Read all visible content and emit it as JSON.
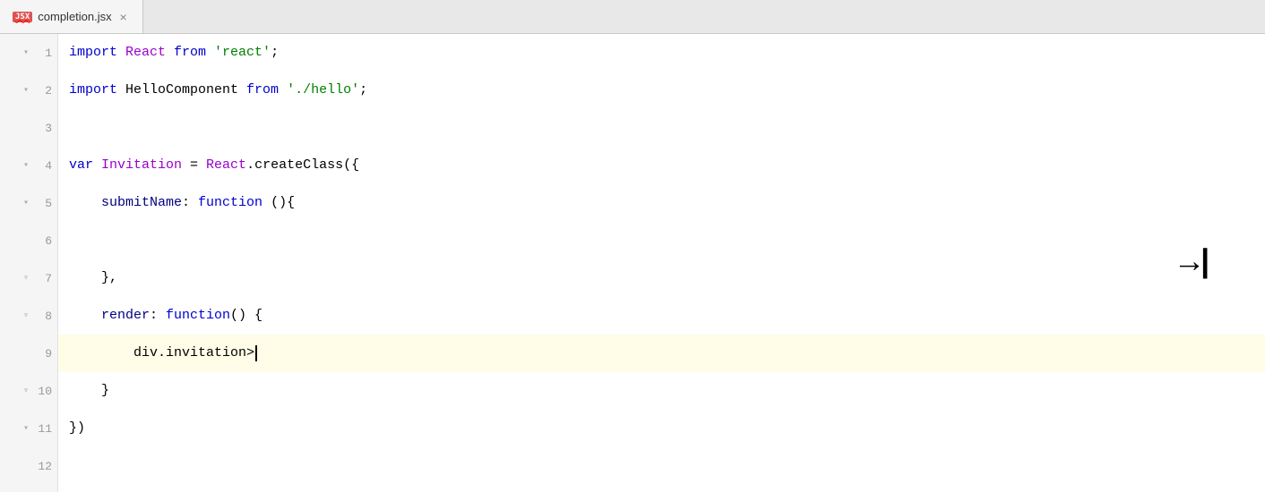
{
  "tab": {
    "icon_label": "JSX",
    "filename": "completion.jsx",
    "close_label": "×"
  },
  "lines": [
    {
      "num": "1",
      "fold": "▾",
      "has_fold": true,
      "tokens": [
        {
          "type": "kw",
          "text": "import "
        },
        {
          "type": "react-name",
          "text": "React"
        },
        {
          "type": "from-kw",
          "text": " from "
        },
        {
          "type": "string-green",
          "text": "'react'"
        },
        {
          "type": "plain",
          "text": ";"
        }
      ],
      "active": false
    },
    {
      "num": "2",
      "fold": "▾",
      "has_fold": true,
      "tokens": [
        {
          "type": "kw",
          "text": "import "
        },
        {
          "type": "plain",
          "text": "HelloComponent"
        },
        {
          "type": "from-kw",
          "text": " from "
        },
        {
          "type": "string-green",
          "text": "'./hello'"
        },
        {
          "type": "plain",
          "text": ";"
        }
      ],
      "active": false
    },
    {
      "num": "3",
      "fold": "",
      "has_fold": false,
      "tokens": [],
      "active": false
    },
    {
      "num": "4",
      "fold": "▾",
      "has_fold": true,
      "tokens": [
        {
          "type": "kw",
          "text": "var "
        },
        {
          "type": "var-name",
          "text": "Invitation"
        },
        {
          "type": "plain",
          "text": " = "
        },
        {
          "type": "react-name",
          "text": "React"
        },
        {
          "type": "plain",
          "text": ".createClass({"
        }
      ],
      "active": false
    },
    {
      "num": "5",
      "fold": "▾",
      "has_fold": true,
      "tokens": [
        {
          "type": "method-name",
          "text": "    submitName"
        },
        {
          "type": "plain",
          "text": ": "
        },
        {
          "type": "func-kw",
          "text": "function "
        },
        {
          "type": "plain",
          "text": "(){"
        }
      ],
      "active": false
    },
    {
      "num": "6",
      "fold": "",
      "has_fold": false,
      "tokens": [],
      "active": false
    },
    {
      "num": "7",
      "fold": "▿",
      "has_fold": true,
      "tokens": [
        {
          "type": "plain",
          "text": "    },"
        }
      ],
      "active": false
    },
    {
      "num": "8",
      "fold": "▿",
      "has_fold": true,
      "tokens": [
        {
          "type": "method-name",
          "text": "    render"
        },
        {
          "type": "plain",
          "text": ": "
        },
        {
          "type": "func-kw",
          "text": "function"
        },
        {
          "type": "plain",
          "text": "() {"
        }
      ],
      "active": false
    },
    {
      "num": "9",
      "fold": "",
      "has_fold": false,
      "tokens": [
        {
          "type": "plain",
          "text": "        div.invitation>"
        },
        {
          "type": "error",
          "text": ""
        }
      ],
      "active": true
    },
    {
      "num": "10",
      "fold": "▿",
      "has_fold": true,
      "tokens": [
        {
          "type": "plain",
          "text": "    }"
        }
      ],
      "active": false
    },
    {
      "num": "11",
      "fold": "▾",
      "has_fold": true,
      "tokens": [
        {
          "type": "plain",
          "text": "})"
        }
      ],
      "active": false
    },
    {
      "num": "12",
      "fold": "",
      "has_fold": false,
      "tokens": [],
      "active": false
    }
  ],
  "arrow": "→|"
}
